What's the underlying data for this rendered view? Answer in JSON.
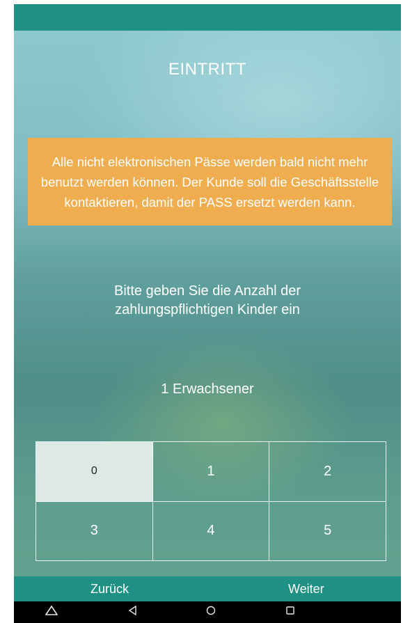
{
  "screen": {
    "title": "EINTRITT",
    "notice": "Alle nicht elektronischen Pässe werden bald nicht mehr benutzt werden können. Der Kunde soll die Geschäftsstelle kontaktieren, damit der PASS ersetzt werden kann.",
    "prompt": "Bitte geben Sie die Anzahl der zahlungspflichtigen Kinder ein",
    "adults_count": "1 Erwachsener"
  },
  "keypad": {
    "keys": [
      "0",
      "1",
      "2",
      "3",
      "4",
      "5"
    ],
    "selected_value": "0"
  },
  "footer": {
    "back_label": "Zurück",
    "next_label": "Weiter"
  },
  "system_nav": {
    "icons": [
      "home-triangle-icon",
      "back-icon",
      "home-icon",
      "recents-icon"
    ]
  },
  "colors": {
    "bar": "#1f9084",
    "notice": "#efad50",
    "selected_key": "#dce9e5"
  }
}
